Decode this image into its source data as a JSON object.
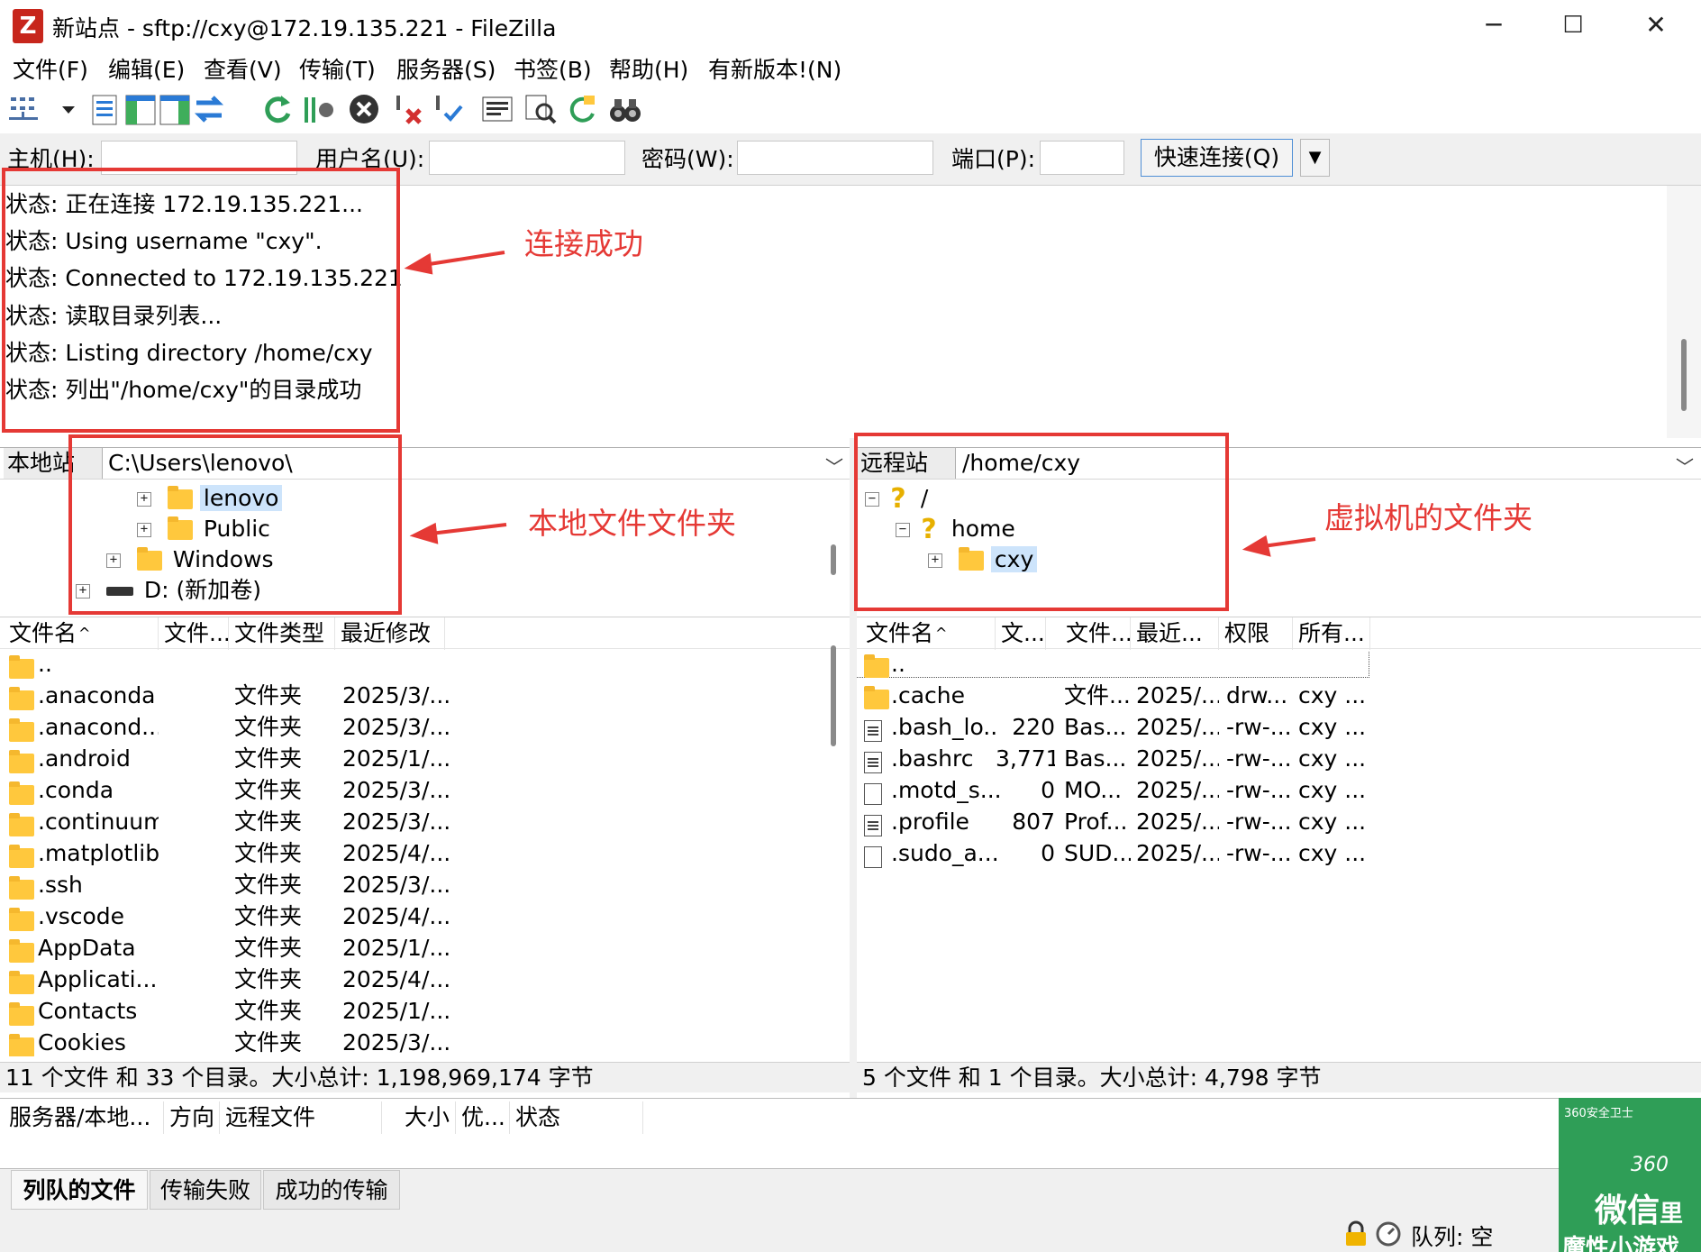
{
  "window": {
    "title": "新站点 - sftp://cxy@172.19.135.221 - FileZilla",
    "logo": "Z",
    "controls": [
      "─",
      "☐",
      "✕"
    ]
  },
  "menu": [
    "文件(F)",
    "编辑(E)",
    "查看(V)",
    "传输(T)",
    "服务器(S)",
    "书签(B)",
    "帮助(H)",
    "有新版本!(N)"
  ],
  "toolbar_icons": [
    "site-manager-icon",
    "dropdown-arrow-icon",
    "toggle-message-log-icon",
    "toggle-local-tree-icon",
    "toggle-remote-tree-icon",
    "toggle-transfer-queue-icon",
    "refresh-icon",
    "process-queue-icon",
    "cancel-icon",
    "disconnect-icon",
    "reconnect-icon",
    "directory-comparison-icon",
    "filter-icon",
    "sync-browsing-icon",
    "search-remote-icon"
  ],
  "quickconnect": {
    "host_label": "主机(H):",
    "user_label": "用户名(U):",
    "pass_label": "密码(W):",
    "port_label": "端口(P):",
    "host_value": "",
    "user_value": "",
    "pass_value": "",
    "port_value": "",
    "button_label": "快速连接(Q)",
    "dropdown": "▼"
  },
  "log": [
    "状态: 正在连接 172.19.135.221...",
    "状态: Using username \"cxy\".",
    "状态: Connected to 172.19.135.221",
    "状态: 读取目录列表...",
    "状态: Listing directory /home/cxy",
    "状态: 列出\"/home/cxy\"的目录成功"
  ],
  "local": {
    "label": "本地站点:",
    "path": "C:\\Users\\lenovo\\",
    "chevron": "﹀",
    "tree": [
      {
        "expander": "+",
        "icon": "folder",
        "name": "lenovo",
        "selected": true
      },
      {
        "expander": "+",
        "icon": "folder",
        "name": "Public"
      },
      {
        "expander": "+",
        "icon": "folder",
        "name": "Windows"
      },
      {
        "expander": "+",
        "icon": "drive",
        "name": "D: (新加卷)"
      }
    ],
    "columns": [
      "文件名",
      "文件...",
      "文件类型",
      "最近修改"
    ],
    "sort_indicator": "^",
    "rows": [
      {
        "name": "..",
        "size": "",
        "type": "",
        "modified": ""
      },
      {
        "name": ".anaconda",
        "size": "",
        "type": "文件夹",
        "modified": "2025/3/..."
      },
      {
        "name": ".anacond...",
        "size": "",
        "type": "文件夹",
        "modified": "2025/3/..."
      },
      {
        "name": ".android",
        "size": "",
        "type": "文件夹",
        "modified": "2025/1/..."
      },
      {
        "name": ".conda",
        "size": "",
        "type": "文件夹",
        "modified": "2025/3/..."
      },
      {
        "name": ".continuum",
        "size": "",
        "type": "文件夹",
        "modified": "2025/3/..."
      },
      {
        "name": ".matplotlib",
        "size": "",
        "type": "文件夹",
        "modified": "2025/4/..."
      },
      {
        "name": ".ssh",
        "size": "",
        "type": "文件夹",
        "modified": "2025/3/..."
      },
      {
        "name": ".vscode",
        "size": "",
        "type": "文件夹",
        "modified": "2025/4/..."
      },
      {
        "name": "AppData",
        "size": "",
        "type": "文件夹",
        "modified": "2025/1/..."
      },
      {
        "name": "Applicati...",
        "size": "",
        "type": "文件夹",
        "modified": "2025/4/..."
      },
      {
        "name": "Contacts",
        "size": "",
        "type": "文件夹",
        "modified": "2025/1/..."
      },
      {
        "name": "Cookies",
        "size": "",
        "type": "文件夹",
        "modified": "2025/3/..."
      }
    ],
    "status": "11 个文件 和 33 个目录。大小总计: 1,198,969,174 字节"
  },
  "remote": {
    "label": "远程站点:",
    "path": "/home/cxy",
    "chevron": "﹀",
    "tree": [
      {
        "expander": "−",
        "icon": "question",
        "name": "/"
      },
      {
        "expander": "−",
        "icon": "question",
        "name": "home"
      },
      {
        "expander": "+",
        "icon": "folder",
        "name": "cxy",
        "selected": true
      }
    ],
    "columns": [
      "文件名",
      "文...",
      "文件...",
      "最近...",
      "权限",
      "所有..."
    ],
    "sort_indicator": "^",
    "rows": [
      {
        "icon": "folder",
        "name": "..",
        "size": "",
        "type": "",
        "modified": "",
        "perm": "",
        "owner": ""
      },
      {
        "icon": "folder",
        "name": ".cache",
        "size": "",
        "type": "文件...",
        "modified": "2025/...",
        "perm": "drw...",
        "owner": "cxy ..."
      },
      {
        "icon": "text",
        "name": ".bash_lo...",
        "size": "220",
        "type": "Bas...",
        "modified": "2025/...",
        "perm": "-rw-...",
        "owner": "cxy ..."
      },
      {
        "icon": "text",
        "name": ".bashrc",
        "size": "3,771",
        "type": "Bas...",
        "modified": "2025/...",
        "perm": "-rw-...",
        "owner": "cxy ..."
      },
      {
        "icon": "blank",
        "name": ".motd_s...",
        "size": "0",
        "type": "MO...",
        "modified": "2025/...",
        "perm": "-rw-...",
        "owner": "cxy ..."
      },
      {
        "icon": "text",
        "name": ".profile",
        "size": "807",
        "type": "Prof...",
        "modified": "2025/...",
        "perm": "-rw-...",
        "owner": "cxy ..."
      },
      {
        "icon": "blank",
        "name": ".sudo_a...",
        "size": "0",
        "type": "SUD...",
        "modified": "2025/...",
        "perm": "-rw-...",
        "owner": "cxy ..."
      }
    ],
    "status": "5 个文件 和 1 个目录。大小总计: 4,798 字节"
  },
  "queue": {
    "columns": [
      "服务器/本地...",
      "方向",
      "远程文件",
      "大小",
      "优...",
      "状态"
    ],
    "tabs": [
      "列队的文件",
      "传输失败",
      "成功的传输"
    ],
    "active_tab": 0,
    "status_text": "队列: 空"
  },
  "annotations": {
    "connect_success": "连接成功",
    "local_folder": "本地文件文件夹",
    "vm_folder": "虚拟机的文件夹",
    "color": "#e53935"
  },
  "ad": {
    "brand": "360安全卫士",
    "logo_text": "360",
    "line1": "微信",
    "line1b": "里",
    "line2": "魔性小游戏"
  }
}
